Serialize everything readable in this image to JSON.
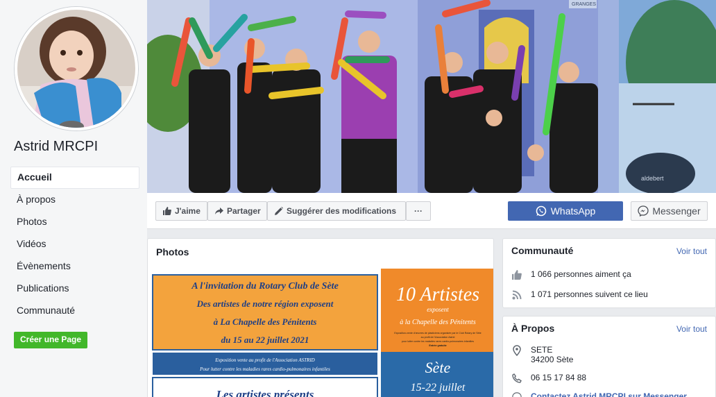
{
  "page": {
    "name": "Astrid MRCPI"
  },
  "sidebar": {
    "items": [
      {
        "label": "Accueil",
        "active": true
      },
      {
        "label": "À propos"
      },
      {
        "label": "Photos"
      },
      {
        "label": "Vidéos"
      },
      {
        "label": "Évènements"
      },
      {
        "label": "Publications"
      },
      {
        "label": "Communauté"
      }
    ],
    "create_page": "Créer une Page"
  },
  "cover": {
    "sign_text": "GRANGES",
    "drum_text": "aldebert"
  },
  "actions": {
    "like": "J'aime",
    "share": "Partager",
    "suggest": "Suggérer des modifications",
    "more": "···",
    "whatsapp": "WhatsApp",
    "messenger": "Messenger"
  },
  "photos": {
    "title": "Photos",
    "poster1": {
      "line1": "A l'invitation du Rotary Club de Sète",
      "line2": "Des artistes de notre région exposent",
      "line3": "à La Chapelle des Pénitents",
      "line4": "du 15 au 22 juillet 2021",
      "band1": "Exposition vente au profit de l'Association ASTRID",
      "band2": "Pour lutter contre les maladies rares cardio-pulmonaires infantiles",
      "bottom": "Les artistes présents"
    },
    "poster2": {
      "title": "10 Artistes",
      "sub1": "exposent",
      "sub2": "à la Chapelle des Pénitents",
      "small1": "Exposition-vente d'œuvres de plasticiens organisée par le Club Rotary de Sète",
      "small2": "au profit de l'Association Astrid",
      "small3": "pour lutter contre les maladies rares cardio-pulmonaires infantiles",
      "small4": "Entrée gratuite",
      "city": "Sète",
      "dates": "15-22 juillet"
    }
  },
  "community": {
    "title": "Communauté",
    "see_all": "Voir tout",
    "likes": "1 066 personnes aiment ça",
    "follows": "1 071 personnes suivent ce lieu"
  },
  "about": {
    "title": "À Propos",
    "see_all": "Voir tout",
    "city": "SETE",
    "postal": "34200 Sète",
    "phone": "06 15 17 84 88",
    "contact": "Contactez Astrid MRCPI sur Messenger"
  },
  "colors": {
    "fb_blue": "#4267b2",
    "green": "#42b72a",
    "poster_orange": "#f3a33d",
    "poster_blue": "#2a5f9e"
  }
}
